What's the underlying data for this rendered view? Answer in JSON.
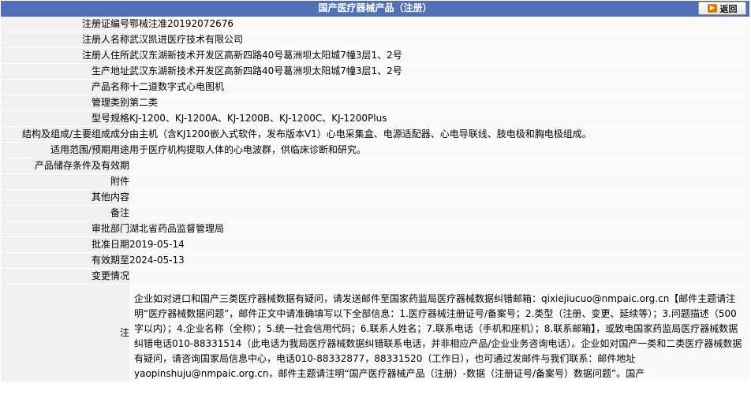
{
  "header": {
    "title": "国产医疗器械产品（注册）",
    "back_label": "返回"
  },
  "rows": [
    {
      "label": "注册证编号",
      "value": "鄂械注准20192072676"
    },
    {
      "label": "注册人名称",
      "value": "武汉凯进医疗技术有限公司"
    },
    {
      "label": "注册人住所",
      "value": "武汉东湖新技术开发区高新四路40号葛洲坝太阳城7幢3层1、2号"
    },
    {
      "label": "生产地址",
      "value": "武汉东湖新技术开发区高新四路40号葛洲坝太阳城7幢3层1、2号"
    },
    {
      "label": "产品名称",
      "value": "十二道数字式心电图机"
    },
    {
      "label": "管理类别",
      "value": "第二类"
    },
    {
      "label": "型号规格",
      "value": "KJ-1200、KJ-1200A、KJ-1200B、KJ-1200C、KJ-1200Plus"
    },
    {
      "label": "结构及组成/主要组成成分",
      "value": "由主机（含KJ1200嵌入式软件，发布版本V1）心电采集盒、电源适配器、心电导联线、肢电极和胸电极组成。"
    },
    {
      "label": "适用范围/预期用途",
      "value": "用于医疗机构提取人体的心电波群，供临床诊断和研究。"
    },
    {
      "label": "产品储存条件及有效期",
      "value": ""
    },
    {
      "label": "附件",
      "value": ""
    },
    {
      "label": "其他内容",
      "value": ""
    },
    {
      "label": "备注",
      "value": ""
    },
    {
      "label": "审批部门",
      "value": "湖北省药品监督管理局"
    },
    {
      "label": "批准日期",
      "value": "2019-05-14"
    },
    {
      "label": "有效期至",
      "value": "2024-05-13"
    },
    {
      "label": "变更情况",
      "value": ""
    }
  ],
  "note": {
    "label": "注",
    "text": "企业如对进口和国产三类医疗器械数据有疑问，请发送邮件至国家药监局医疗器械数据纠错邮箱：qixiejiucuo@nmpaic.org.cn【邮件主题请注明“医疗器械数据问题”，邮件正文中请准确填写以下全部信息：1.医疗器械注册证号/备案号；2.类型（注册、变更、延续等）；3.问题描述（500字以内）；4.企业名称（全称）；5.统一社会信用代码；6.联系人姓名；7.联系电话（手机和座机）；8.联系邮箱】，或致电国家药监局医疗器械数据纠错电话010-88331514（此电话为我局医疗器械数据纠错联系电话，并非相应产品/企业业务咨询电话）。企业如对国产一类和二类医疗器械数据有疑问，请咨询国家局信息中心，电话010-88332877，88331520（工作日），也可通过发邮件与我们联系：邮件地址yaopinshuju@nmpaic.org.cn，邮件主题请注明“国产医疗器械产品（注册）-数据（注册证号/备案号）数据问题”。国产"
  }
}
